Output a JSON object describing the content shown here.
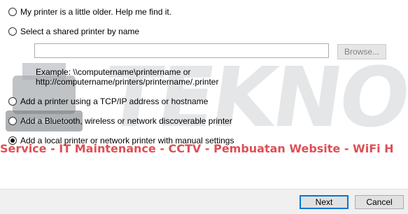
{
  "options": [
    {
      "label": "My printer is a little older. Help me find it.",
      "selected": false
    },
    {
      "label": "Select a shared printer by name",
      "selected": false
    },
    {
      "label": "Add a printer using a TCP/IP address or hostname",
      "selected": false
    },
    {
      "label": "Add a Bluetooth, wireless or network discoverable printer",
      "selected": false
    },
    {
      "label": "Add a local printer or network printer with manual settings",
      "selected": true
    }
  ],
  "shared_printer": {
    "value": "",
    "browse_label": "Browse...",
    "example_line1": "Example: \\\\computername\\printername or",
    "example_line2": "http://computername/printers/printername/.printer"
  },
  "footer": {
    "next_label": "Next",
    "cancel_label": "Cancel"
  },
  "watermark": {
    "brand": "TEKNODY",
    "tagline": "Service - IT Maintenance - CCTV - Pembuatan Website - WiFi H"
  },
  "colors": {
    "accent": "#0078d7",
    "watermark_red": "#d8232a"
  }
}
